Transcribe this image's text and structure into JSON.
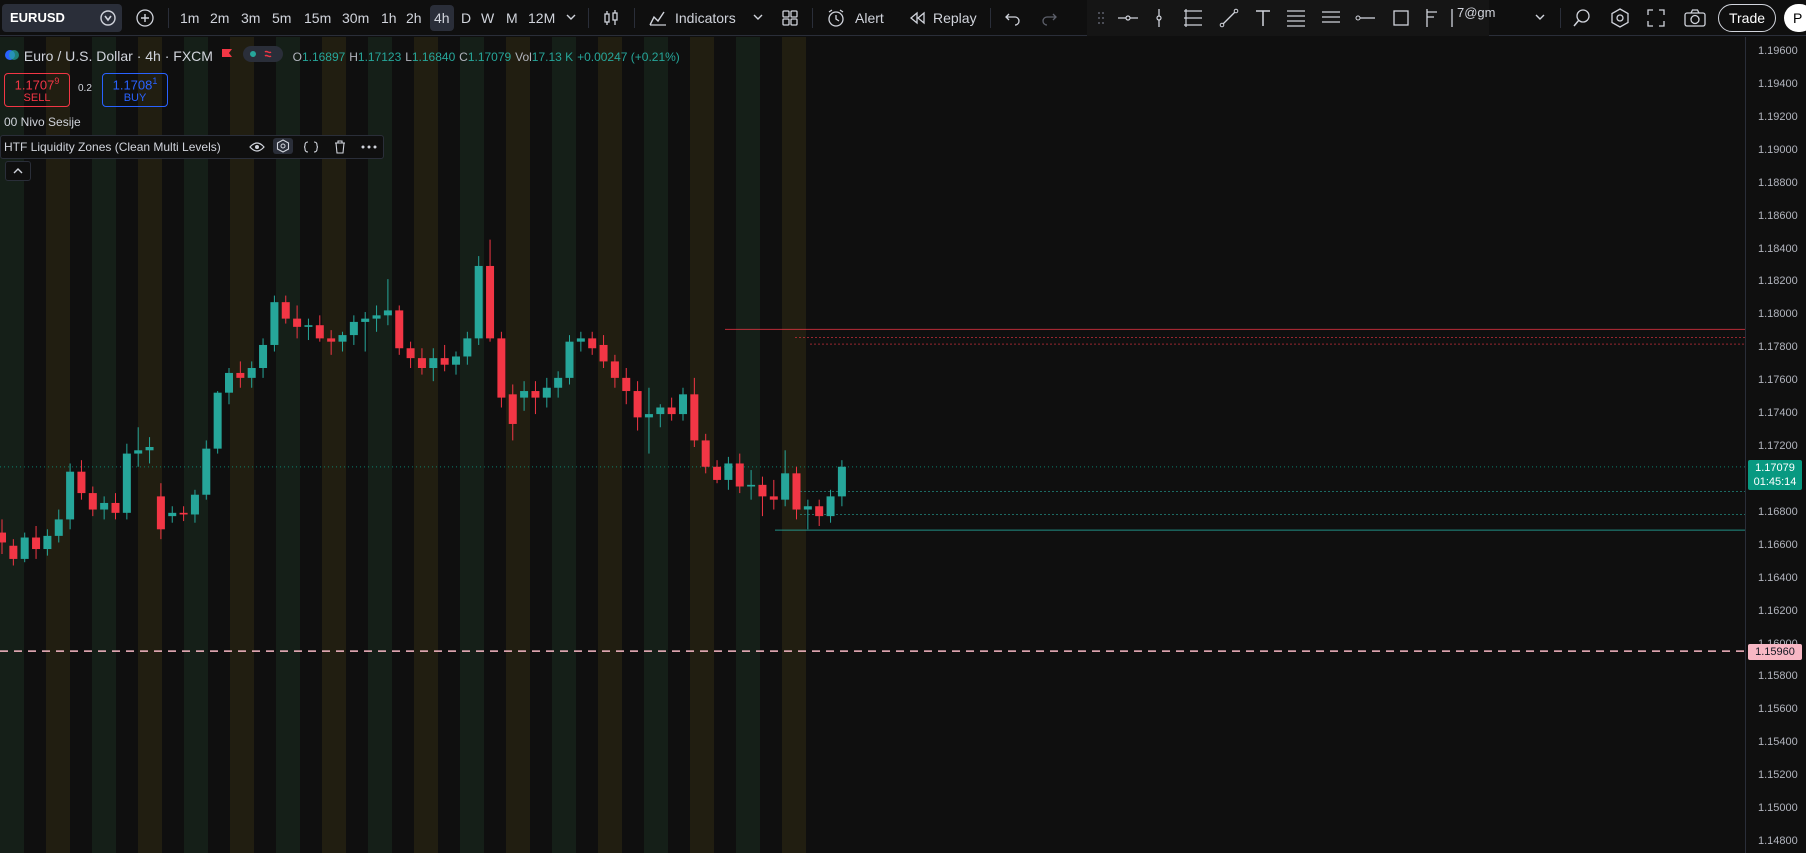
{
  "toolbar": {
    "symbol": "EURUSD",
    "timeframes": [
      "1m",
      "2m",
      "3m",
      "5m",
      "15m",
      "30m",
      "1h",
      "2h",
      "4h",
      "D",
      "W",
      "M",
      "12M"
    ],
    "active_timeframe": "4h",
    "indicators_label": "Indicators",
    "alert_label": "Alert",
    "replay_label": "Replay",
    "account_fragment": "7@gm",
    "trade_label": "Trade",
    "profile_initial": "P"
  },
  "legend": {
    "title": "Euro / U.S. Dollar · 4h · FXCM",
    "o_label": "O",
    "o": "1.16897",
    "h_label": "H",
    "h": "1.17123",
    "l_label": "L",
    "l": "1.16840",
    "c_label": "C",
    "c": "1.17079",
    "vol_label": "Vol",
    "vol": "17.13 K",
    "change": "+0.00247 (+0.21%)"
  },
  "trade": {
    "sell_price": "1.1707",
    "sell_sup": "9",
    "sell_label": "SELL",
    "spread": "0.2",
    "buy_price": "1.1708",
    "buy_sup": "1",
    "buy_label": "BUY"
  },
  "studies": {
    "session": "00 Nivo Sesije",
    "indicator": "HTF Liquidity Zones (Clean Multi Levels)"
  },
  "price_axis": {
    "ticks": [
      "1.19600",
      "1.19400",
      "1.19200",
      "1.19000",
      "1.18800",
      "1.18600",
      "1.18400",
      "1.18200",
      "1.18000",
      "1.17800",
      "1.17600",
      "1.17400",
      "1.17200",
      "1.17000",
      "1.16800",
      "1.16600",
      "1.16400",
      "1.16200",
      "1.16000",
      "1.15800",
      "1.15600",
      "1.15400",
      "1.15200",
      "1.15000",
      "1.14800"
    ],
    "current_price": "1.17079",
    "countdown": "01:45:14",
    "alert_price": "1.15960"
  },
  "colors": {
    "up": "#26a69a",
    "down": "#f23645",
    "background": "#0f0f0f",
    "alert_line": "#f7b7c4"
  },
  "chart_data": {
    "type": "candlestick",
    "symbol": "EURUSD",
    "interval": "4h",
    "ylim": [
      1.148,
      1.196
    ],
    "candles": [
      [
        1.1668,
        1.1676,
        1.1655,
        1.1662
      ],
      [
        1.166,
        1.1664,
        1.1648,
        1.1652
      ],
      [
        1.1652,
        1.1668,
        1.165,
        1.1665
      ],
      [
        1.1665,
        1.1672,
        1.1652,
        1.1658
      ],
      [
        1.1658,
        1.167,
        1.1654,
        1.1666
      ],
      [
        1.1666,
        1.1682,
        1.1662,
        1.1676
      ],
      [
        1.1676,
        1.171,
        1.167,
        1.1705
      ],
      [
        1.1705,
        1.1712,
        1.1688,
        1.1692
      ],
      [
        1.1692,
        1.1696,
        1.1678,
        1.1682
      ],
      [
        1.1682,
        1.169,
        1.1676,
        1.1686
      ],
      [
        1.1686,
        1.1692,
        1.1676,
        1.168
      ],
      [
        1.168,
        1.1722,
        1.1676,
        1.1716
      ],
      [
        1.1716,
        1.1732,
        1.1708,
        1.1718
      ],
      [
        1.1718,
        1.1726,
        1.171,
        1.172
      ],
      [
        1.169,
        1.1698,
        1.1664,
        1.167
      ],
      [
        1.1678,
        1.1684,
        1.1674,
        1.168
      ],
      [
        1.168,
        1.1684,
        1.1675,
        1.1679
      ],
      [
        1.1679,
        1.1694,
        1.1674,
        1.1691
      ],
      [
        1.1691,
        1.1724,
        1.1688,
        1.1719
      ],
      [
        1.1719,
        1.1754,
        1.1716,
        1.1753
      ],
      [
        1.1753,
        1.1768,
        1.1746,
        1.1765
      ],
      [
        1.1765,
        1.1772,
        1.1756,
        1.1762
      ],
      [
        1.1762,
        1.1772,
        1.1756,
        1.1768
      ],
      [
        1.1768,
        1.1786,
        1.1762,
        1.1782
      ],
      [
        1.1782,
        1.1812,
        1.1778,
        1.1808
      ],
      [
        1.1808,
        1.1812,
        1.1795,
        1.1798
      ],
      [
        1.1798,
        1.1806,
        1.1786,
        1.1793
      ],
      [
        1.1793,
        1.1798,
        1.1785,
        1.1794
      ],
      [
        1.1794,
        1.18,
        1.1784,
        1.1786
      ],
      [
        1.1786,
        1.1791,
        1.1776,
        1.1784
      ],
      [
        1.1784,
        1.179,
        1.1778,
        1.1788
      ],
      [
        1.1788,
        1.18,
        1.1782,
        1.1796
      ],
      [
        1.1796,
        1.1802,
        1.1778,
        1.1798
      ],
      [
        1.1798,
        1.1806,
        1.179,
        1.18
      ],
      [
        1.18,
        1.1822,
        1.1794,
        1.1803
      ],
      [
        1.1803,
        1.1806,
        1.1776,
        1.178
      ],
      [
        1.178,
        1.1784,
        1.1768,
        1.1774
      ],
      [
        1.1774,
        1.178,
        1.1764,
        1.1768
      ],
      [
        1.1768,
        1.178,
        1.176,
        1.1774
      ],
      [
        1.1774,
        1.1782,
        1.1766,
        1.177
      ],
      [
        1.177,
        1.1778,
        1.1764,
        1.1775
      ],
      [
        1.1775,
        1.179,
        1.177,
        1.1786
      ],
      [
        1.1786,
        1.1836,
        1.1782,
        1.183
      ],
      [
        1.183,
        1.1846,
        1.1784,
        1.1786
      ],
      [
        1.1786,
        1.179,
        1.1744,
        1.175
      ],
      [
        1.1752,
        1.1758,
        1.1724,
        1.1734
      ],
      [
        1.175,
        1.176,
        1.1742,
        1.1754
      ],
      [
        1.1754,
        1.176,
        1.174,
        1.175
      ],
      [
        1.175,
        1.1762,
        1.1744,
        1.1756
      ],
      [
        1.1756,
        1.1766,
        1.175,
        1.1762
      ],
      [
        1.1762,
        1.1788,
        1.1758,
        1.1784
      ],
      [
        1.1784,
        1.179,
        1.1778,
        1.1786
      ],
      [
        1.1786,
        1.179,
        1.1776,
        1.178
      ],
      [
        1.1782,
        1.1788,
        1.1768,
        1.1772
      ],
      [
        1.1772,
        1.1776,
        1.1756,
        1.1762
      ],
      [
        1.1762,
        1.1768,
        1.1746,
        1.1754
      ],
      [
        1.1754,
        1.176,
        1.173,
        1.1738
      ],
      [
        1.1738,
        1.1756,
        1.1716,
        1.174
      ],
      [
        1.174,
        1.1746,
        1.1732,
        1.1744
      ],
      [
        1.1744,
        1.175,
        1.1736,
        1.174
      ],
      [
        1.174,
        1.1756,
        1.1736,
        1.1752
      ],
      [
        1.1752,
        1.1762,
        1.172,
        1.1724
      ],
      [
        1.1724,
        1.1728,
        1.1704,
        1.1708
      ],
      [
        1.1708,
        1.1712,
        1.1698,
        1.17
      ],
      [
        1.17,
        1.1714,
        1.1694,
        1.171
      ],
      [
        1.171,
        1.1716,
        1.1692,
        1.1696
      ],
      [
        1.1696,
        1.1706,
        1.1688,
        1.1697
      ],
      [
        1.1697,
        1.1702,
        1.1678,
        1.169
      ],
      [
        1.169,
        1.17,
        1.1682,
        1.1688
      ],
      [
        1.1688,
        1.1718,
        1.1684,
        1.1704
      ],
      [
        1.1704,
        1.1708,
        1.1676,
        1.1682
      ],
      [
        1.1682,
        1.1688,
        1.167,
        1.1684
      ],
      [
        1.1684,
        1.1688,
        1.1672,
        1.1678
      ],
      [
        1.1678,
        1.1694,
        1.1674,
        1.169
      ],
      [
        1.169,
        1.1712,
        1.1684,
        1.1708
      ]
    ]
  }
}
